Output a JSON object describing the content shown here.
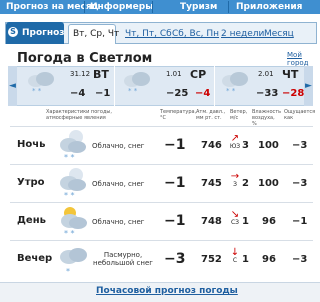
{
  "topnav": {
    "items": [
      "Прогноз на месяц",
      "Информеры",
      "Туризм",
      "Приложения"
    ]
  },
  "tabs": {
    "prognoz": "Прогноз",
    "selected": "Вт, Ср, Чт",
    "links": [
      "Чт, Пт, Сб",
      "Сб, Вс, Пн",
      "2 недели",
      "Месяц"
    ]
  },
  "heading": {
    "title": "Погода в Светлом",
    "my_place": "Мой город"
  },
  "days": [
    {
      "date": "31.12",
      "weekday": "ВТ",
      "temp_day": "−4",
      "temp_night": "−1",
      "weekend": false
    },
    {
      "date": "1.01",
      "weekday": "СР",
      "temp_day": "−25",
      "temp_night": "−4",
      "weekend": false
    },
    {
      "date": "2.01",
      "weekday": "ЧТ",
      "temp_day": "−33",
      "temp_night": "−28",
      "weekend": true
    }
  ],
  "columns": {
    "characteristics": "Характеристики погоды, атмосферные явления",
    "temperature": "Температура, °C",
    "pressure": "Атм. давл., мм рт. ст.",
    "wind": "Ветер, м/с",
    "humidity": "Влажность воздуха, %",
    "feels_like": "Ощущается как"
  },
  "rows": [
    {
      "period": "Ночь",
      "desc": "Облачно, снег",
      "temp": "−1",
      "pressure": "746",
      "wind_dir": "ЮЗ",
      "wind_speed": "3",
      "humidity": "100",
      "feels": "−3"
    },
    {
      "period": "Утро",
      "desc": "Облачно, снег",
      "temp": "−1",
      "pressure": "745",
      "wind_dir": "З",
      "wind_speed": "2",
      "humidity": "100",
      "feels": "−3"
    },
    {
      "period": "День",
      "desc": "Облачно, снег",
      "temp": "−1",
      "pressure": "748",
      "wind_dir": "СЗ",
      "wind_speed": "1",
      "humidity": "96",
      "feels": "−1"
    },
    {
      "period": "Вечер",
      "desc": "Пасмурно, небольшой снег",
      "temp": "−3",
      "pressure": "752",
      "wind_dir": "С",
      "wind_speed": "1",
      "humidity": "96",
      "feels": "−3"
    }
  ],
  "footer": {
    "link": "Почасовой прогноз погоды"
  },
  "colors": {
    "brand": "#1f6aa8",
    "nav": "#3f8fd0",
    "negative_weekend": "#c00000"
  }
}
